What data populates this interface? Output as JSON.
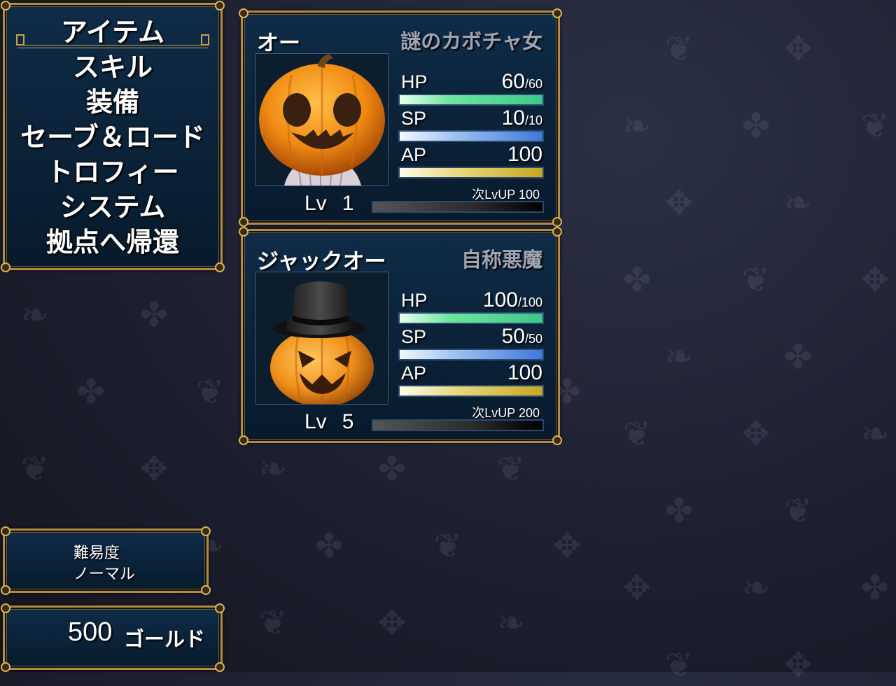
{
  "menu": {
    "items": [
      {
        "label": "アイテム",
        "selected": true
      },
      {
        "label": "スキル",
        "selected": false
      },
      {
        "label": "装備",
        "selected": false
      },
      {
        "label": "セーブ＆ロード",
        "selected": false
      },
      {
        "label": "トロフィー",
        "selected": false
      },
      {
        "label": "システム",
        "selected": false
      },
      {
        "label": "拠点へ帰還",
        "selected": false
      }
    ]
  },
  "actors": [
    {
      "name": "オー",
      "class": "謎のカボチャ女",
      "portrait_icon": "pumpkin-head-girl-icon",
      "hp": {
        "label": "HP",
        "value": "60",
        "max": "/60",
        "fill": 1.0
      },
      "sp": {
        "label": "SP",
        "value": "10",
        "max": "/10",
        "fill": 1.0
      },
      "ap": {
        "label": "AP",
        "value": "100",
        "fill": 1.0
      },
      "level_label": "Lv",
      "level": "1",
      "next_level": "次LvUP 100",
      "exp_fill": 0.0
    },
    {
      "name": "ジャックオー",
      "class": "自称悪魔",
      "portrait_icon": "jack-o-lantern-top-hat-icon",
      "hp": {
        "label": "HP",
        "value": "100",
        "max": "/100",
        "fill": 1.0
      },
      "sp": {
        "label": "SP",
        "value": "50",
        "max": "/50",
        "fill": 1.0
      },
      "ap": {
        "label": "AP",
        "value": "100",
        "fill": 1.0
      },
      "level_label": "Lv",
      "level": "5",
      "next_level": "次LvUP 200",
      "exp_fill": 0.0
    }
  ],
  "difficulty": {
    "label": "難易度",
    "value": "ノーマル"
  },
  "gold": {
    "amount": "500",
    "unit": "ゴールド"
  },
  "colors": {
    "frame": "#b58a3c",
    "panel": "#0b2238",
    "hp": "#3cc88a",
    "sp": "#3f78dc",
    "ap": "#c8a820"
  }
}
